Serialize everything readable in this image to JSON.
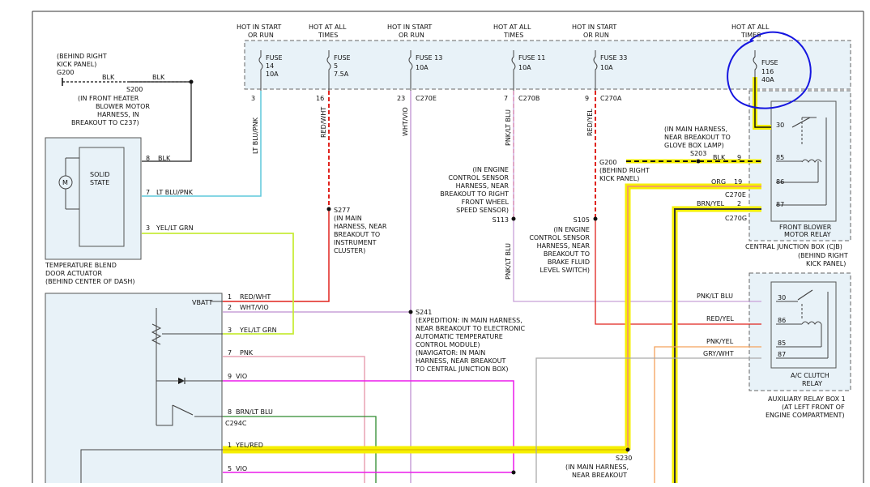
{
  "page_frame": {},
  "fuses": [
    {
      "hot": "HOT IN START",
      "hot2": "OR RUN",
      "name": "FUSE",
      "num": "14",
      "amps": "10A",
      "pin": "3",
      "color": "LT BLU/PNK"
    },
    {
      "hot": "HOT AT ALL",
      "hot2": "TIMES",
      "name": "FUSE",
      "num": "5",
      "amps": "7.5A",
      "pin": "16",
      "color": "RED/WHT"
    },
    {
      "hot": "HOT IN START",
      "hot2": "OR RUN",
      "name": "FUSE 13",
      "num": "",
      "amps": "10A",
      "pin": "23",
      "color": "WHT/VIO",
      "conn": "C270E"
    },
    {
      "hot": "HOT AT ALL",
      "hot2": "TIMES",
      "name": "FUSE 11",
      "num": "",
      "amps": "10A",
      "pin": "7",
      "color": "PNK/LT BLU",
      "conn": "C270B"
    },
    {
      "hot": "HOT IN START",
      "hot2": "OR RUN",
      "name": "FUSE 33",
      "num": "",
      "amps": "10A",
      "pin": "9",
      "color": "RED/YEL",
      "conn": "C270A"
    },
    {
      "hot": "HOT AT ALL",
      "hot2": "TIMES",
      "name": "FUSE",
      "num": "116",
      "amps": "40A",
      "pin": "",
      "color": ""
    }
  ],
  "ground": {
    "loc1": "(BEHIND RIGHT",
    "loc2": "KICK PANEL)",
    "id": "G200",
    "wire1": "BLK",
    "wire2": "BLK",
    "splice": "S200",
    "splice_desc": [
      "(IN FRONT HEATER",
      "BLOWER MOTOR",
      "HARNESS, IN",
      "BREAKOUT TO C237)"
    ]
  },
  "actuator": {
    "label": [
      "SOLID",
      "STATE"
    ],
    "motor": "M",
    "pins": [
      {
        "num": "8",
        "color": "BLK"
      },
      {
        "num": "7",
        "color": "LT BLU/PNK"
      },
      {
        "num": "3",
        "color": "YEL/LT GRN"
      }
    ],
    "title": [
      "TEMPERATURE BLEND",
      "DOOR ACTUATOR",
      "(BEHIND CENTER OF DASH)"
    ]
  },
  "splices": {
    "s277": {
      "id": "S277",
      "desc": [
        "(IN MAIN",
        "HARNESS, NEAR",
        "BREAKOUT TO",
        "INSTRUMENT",
        "CLUSTER)"
      ]
    },
    "s241": {
      "id": "S241",
      "desc": [
        "(EXPEDITION: IN MAIN HARNESS,",
        "NEAR BREAKOUT TO ELECTRONIC",
        "AUTOMATIC TEMPERATURE",
        "CONTROL MODULE)",
        "(NAVIGATOR: IN MAIN",
        "HARNESS, NEAR BREAKOUT",
        "TO CENTRAL JUNCTION BOX)"
      ]
    },
    "s113": {
      "id": "S113",
      "desc": [
        "(IN ENGINE",
        "CONTROL SENSOR",
        "HARNESS, NEAR",
        "BREAKOUT TO RIGHT",
        "FRONT WHEEL",
        "SPEED SENSOR)"
      ]
    },
    "s105": {
      "id": "S105",
      "desc": [
        "(IN ENGINE",
        "CONTROL SENSOR",
        "HARNESS, NEAR",
        "BREAKOUT TO",
        "BRAKE FLUID",
        "LEVEL SWITCH)"
      ]
    },
    "s203": {
      "id": "S203",
      "desc": [
        "(IN MAIN HARNESS,",
        "NEAR BREAKOUT TO",
        "GLOVE BOX LAMP)"
      ]
    },
    "g200b": {
      "id": "G200",
      "desc": [
        "(BEHIND RIGHT",
        "KICK PANEL)"
      ]
    },
    "s230": {
      "id": "S230",
      "desc": [
        "(IN MAIN HARNESS,",
        "NEAR BREAKOUT"
      ]
    }
  },
  "blower_relay": {
    "pins": [
      "30",
      "85",
      "86",
      "87"
    ],
    "wires": [
      {
        "pin": "9",
        "color": "BLK"
      },
      {
        "pin": "19",
        "color": "ORG"
      },
      {
        "pin": "2",
        "color": "BRN/YEL"
      }
    ],
    "conn1": "C270E",
    "conn2": "C270G",
    "title": [
      "FRONT BLOWER",
      "MOTOR RELAY"
    ],
    "cjb": [
      "CENTRAL JUNCTION BOX (CJB)",
      "(BEHIND RIGHT",
      "KICK PANEL)"
    ]
  },
  "ac_relay": {
    "pins": [
      "30",
      "86",
      "85",
      "87"
    ],
    "wires": [
      "PNK/LT BLU",
      "RED/YEL",
      "PNK/YEL",
      "GRY/WHT"
    ],
    "title": [
      "A/C CLUTCH",
      "RELAY"
    ],
    "box": [
      "AUXILIARY RELAY BOX 1",
      "(AT LEFT FRONT OF",
      "ENGINE COMPARTMENT)"
    ]
  },
  "module": {
    "vbatt": "VBATT",
    "conn": "C294C",
    "pins": [
      {
        "num": "1",
        "color": "RED/WHT"
      },
      {
        "num": "2",
        "color": "WHT/VIO"
      },
      {
        "num": "3",
        "color": "YEL/LT GRN"
      },
      {
        "num": "7",
        "color": "PNK"
      },
      {
        "num": "9",
        "color": "VIO"
      },
      {
        "num": "8",
        "color": "BRN/LT BLU"
      },
      {
        "num": "1",
        "color": "YEL/RED"
      },
      {
        "num": "5",
        "color": "VIO"
      }
    ]
  },
  "colors": {
    "highlight": "#f5ef00",
    "annotation": "#1515e0",
    "red": "#e0241e",
    "ltblue": "#5ec8dc",
    "magenta": "#ec1cec",
    "lime": "#c8ec3a",
    "pink": "#e8a4b4",
    "violet_light": "#c8a0d8",
    "orange": "#f4a25c",
    "green": "#2e8b2e",
    "gray": "#aaaaaa"
  }
}
